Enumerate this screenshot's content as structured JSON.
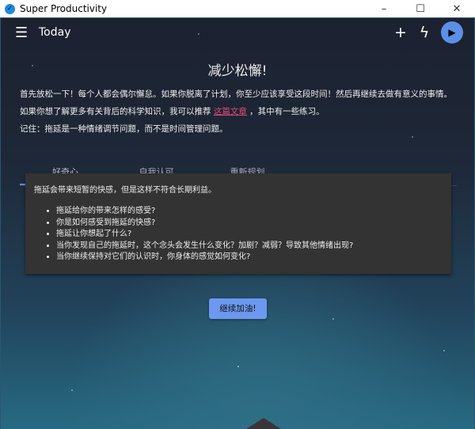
{
  "window": {
    "title": "Super Productivity",
    "minimize": "–",
    "maximize": "☐",
    "close": "✕"
  },
  "header": {
    "title": "Today",
    "add": "+",
    "flash": "ϟ",
    "play": "▶"
  },
  "content": {
    "heading": "减少松懈!",
    "para1": "首先放松一下！每个人都会偶尔懈怠。如果你脱离了计划，你至少应该享受这段时间！然后再继续去做有意义的事情。",
    "para2_before": "如果你想了解更多有关背后的科学知识，我可以推荐 ",
    "para2_link": "这篇文章",
    "para2_after": " ，其中有一些练习。",
    "para3": "记住：拖延是一种情绪调节问题，而不是时间管理问题。",
    "tabs": [
      "好奇心",
      "自我认可",
      "重新规划"
    ],
    "card": {
      "intro": "拖延会带来短暂的快感，但是这样不符合长期利益。",
      "items": [
        "拖延给你的带来怎样的感受?",
        "你是如何感受到拖延的快感?",
        "拖延让你想起了什么?",
        "当你发现自己的拖延时，这个念头会发生什么变化？加剧？减弱？导致其他情绪出现?",
        "当你继续保持对它们的认识时，你身体的感觉如何变化?"
      ]
    },
    "button": "继续加油!"
  }
}
